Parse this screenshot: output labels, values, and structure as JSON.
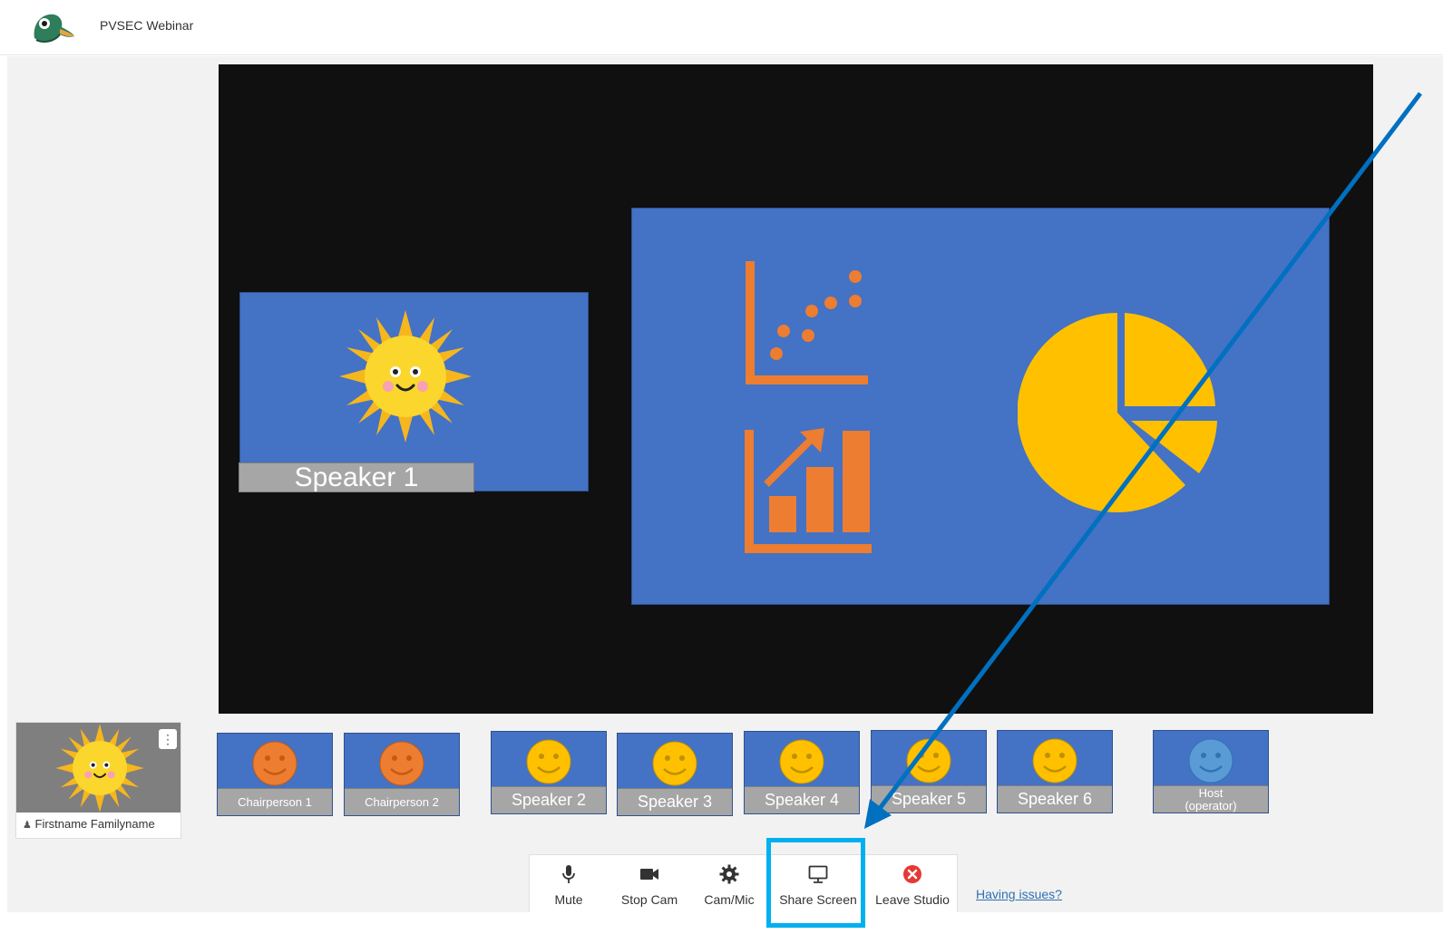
{
  "app": {
    "title": "PVSEC Webinar"
  },
  "stage": {
    "featured_speaker_label": "Speaker 1"
  },
  "self_view": {
    "name": "Firstname Familyname"
  },
  "participants": [
    {
      "label": "Chairperson 1",
      "face_color": "#ed7d31"
    },
    {
      "label": "Chairperson 2",
      "face_color": "#ed7d31"
    },
    {
      "label": "Speaker 2",
      "face_color": "#ffc000"
    },
    {
      "label": "Speaker 3",
      "face_color": "#ffc000"
    },
    {
      "label": "Speaker 4",
      "face_color": "#ffc000"
    },
    {
      "label": "Speaker 5",
      "face_color": "#ffc000"
    },
    {
      "label": "Speaker 6",
      "face_color": "#ffc000"
    },
    {
      "label_line1": "Host",
      "label_line2": "(operator)",
      "face_color": "#5b9bd5"
    }
  ],
  "controls": {
    "mute": "Mute",
    "stop_cam": "Stop Cam",
    "cam_mic": "Cam/Mic",
    "share_screen": "Share Screen",
    "leave_studio": "Leave Studio",
    "having_issues": "Having issues?"
  },
  "colors": {
    "tile_blue": "#4472c4",
    "stage_black": "#101010",
    "plate_gray": "#a6a6a6",
    "slide_orange": "#ed7d31",
    "slide_yellow": "#ffc000",
    "arrow_blue": "#0070c0",
    "highlight_cyan": "#00b0f0",
    "leave_red": "#e53935"
  }
}
